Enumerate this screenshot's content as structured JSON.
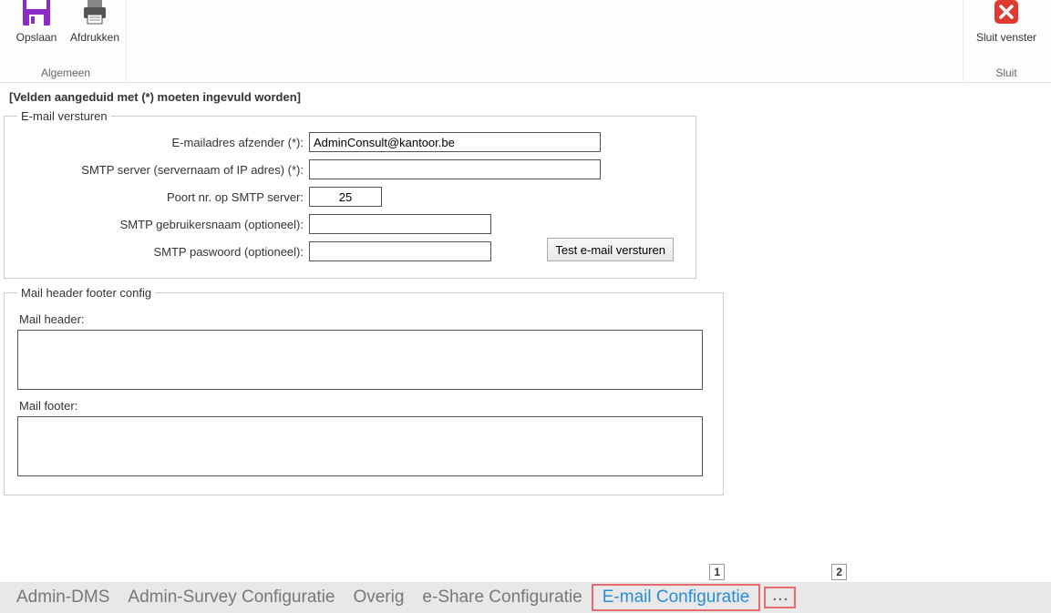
{
  "window": {
    "title_partial": ""
  },
  "ribbon": {
    "group_left_label": "Algemeen",
    "group_right_label": "Sluit",
    "save_label": "Opslaan",
    "print_label": "Afdrukken",
    "close_label": "Sluit venster"
  },
  "hint": "[Velden aangeduid met (*) moeten ingevuld worden]",
  "email_send": {
    "legend": "E-mail versturen",
    "sender_label": "E-mailadres afzender (*):",
    "sender_value": "AdminConsult@kantoor.be",
    "smtp_label": "SMTP server (servernaam of IP adres) (*):",
    "smtp_value": "",
    "port_label": "Poort nr. op SMTP server:",
    "port_value": "25",
    "user_label": "SMTP gebruikersnaam (optioneel):",
    "user_value": "",
    "pass_label": "SMTP paswoord (optioneel):",
    "pass_value": "",
    "test_button": "Test e-mail versturen"
  },
  "mail_config": {
    "legend": "Mail header footer config",
    "header_label": "Mail header:",
    "header_value": "",
    "footer_label": "Mail footer:",
    "footer_value": ""
  },
  "tabs": {
    "items": [
      {
        "label": "Admin-DMS"
      },
      {
        "label": "Admin-Survey Configuratie"
      },
      {
        "label": "Overig"
      },
      {
        "label": "e-Share Configuratie"
      },
      {
        "label": "E-mail Configuratie"
      }
    ],
    "more": "…"
  },
  "callouts": {
    "c1": "1",
    "c2": "2"
  }
}
